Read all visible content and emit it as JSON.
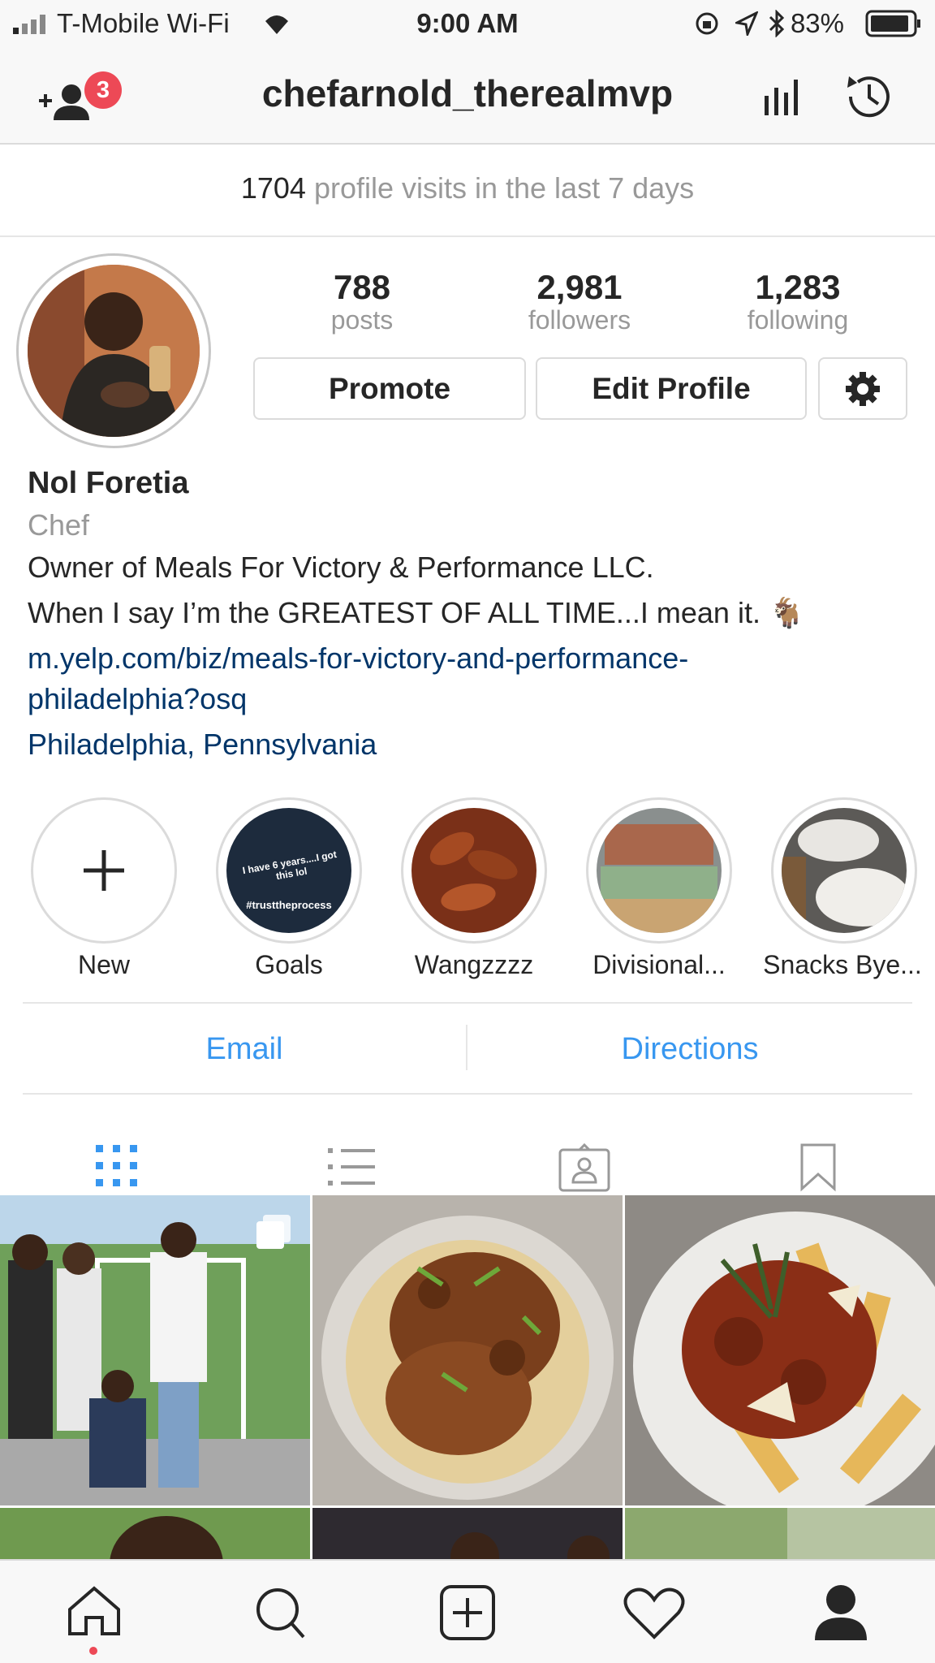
{
  "status_bar": {
    "carrier": "T-Mobile Wi-Fi",
    "time": "9:00 AM",
    "battery": "83%"
  },
  "header": {
    "username": "chefarnold_therealmvp",
    "discover_badge_count": "3"
  },
  "insights": {
    "visits_count": "1704",
    "visits_text": "profile visits in the last 7 days"
  },
  "profile": {
    "stats": [
      {
        "value": "788",
        "label": "posts"
      },
      {
        "value": "2,981",
        "label": "followers"
      },
      {
        "value": "1,283",
        "label": "following"
      }
    ],
    "promote_label": "Promote",
    "edit_label": "Edit Profile",
    "name": "Nol Foretia",
    "category": "Chef",
    "bio_line1": "Owner of Meals For Victory & Performance LLC.",
    "bio_line2": "When I say I’m the GREATEST OF ALL TIME...I mean it. 🐐",
    "website_line1": "m.yelp.com/biz/meals-for-victory-and-performance-",
    "website_line2": "philadelphia?osq",
    "location": "Philadelphia, Pennsylvania"
  },
  "highlights": [
    {
      "label": "New"
    },
    {
      "label": "Goals"
    },
    {
      "label": "Wangzzzz"
    },
    {
      "label": "Divisional..."
    },
    {
      "label": "Snacks Bye..."
    }
  ],
  "goals_story": {
    "line1": "I have 6 years....I got this lol",
    "tag": "#trusttheprocess"
  },
  "contact": {
    "email_label": "Email",
    "directions_label": "Directions"
  },
  "profile_tabs": [
    "grid-view",
    "list-view",
    "tagged",
    "saved"
  ],
  "colors": {
    "link": "#003569",
    "action_blue": "#3897f0",
    "badge_red": "#ed4956",
    "muted": "#999999"
  }
}
